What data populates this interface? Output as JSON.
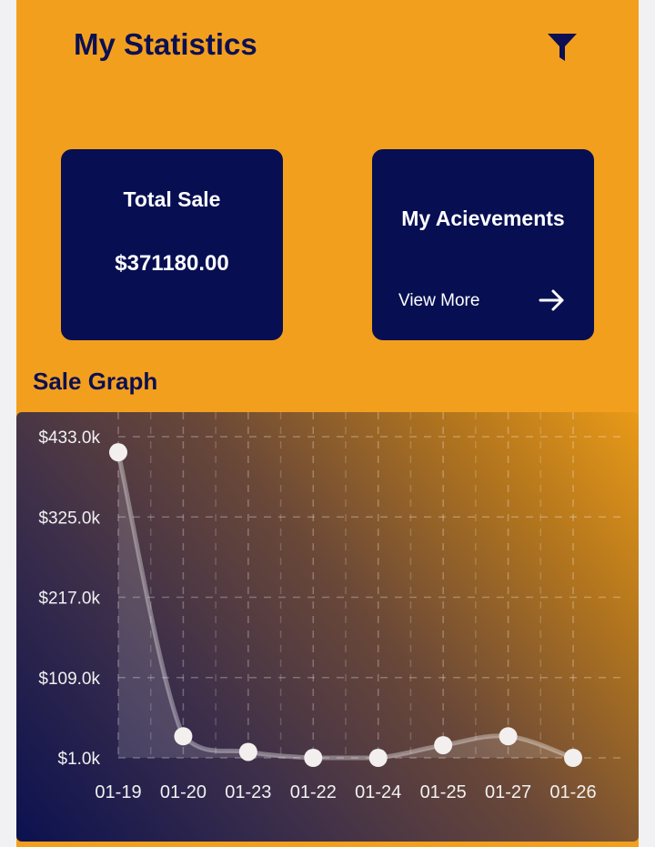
{
  "header": {
    "title": "My Statistics",
    "filter_icon": "filter-icon"
  },
  "cards": {
    "total_sale": {
      "label": "Total Sale",
      "value": "$371180.00"
    },
    "achievements": {
      "label": "My Acievements",
      "link": "View More",
      "arrow_icon": "arrow-right-icon"
    }
  },
  "sale_graph": {
    "title": "Sale Graph"
  },
  "colors": {
    "background": "#f39f1e",
    "card": "#070f52",
    "title_text": "#0c1052"
  },
  "chart_data": {
    "type": "line",
    "categories": [
      "01-19",
      "01-20",
      "01-23",
      "01-22",
      "01-24",
      "01-25",
      "01-27",
      "01-26"
    ],
    "values": [
      412,
      30,
      9,
      1,
      1,
      18,
      30,
      1
    ],
    "y_ticks": [
      "$1.0k",
      "$109.0k",
      "$217.0k",
      "$325.0k",
      "$433.0k"
    ],
    "y_tick_values": [
      1,
      109,
      217,
      325,
      433
    ],
    "ylim": [
      1,
      433
    ],
    "unit": "k",
    "grid": true,
    "smooth": true
  }
}
